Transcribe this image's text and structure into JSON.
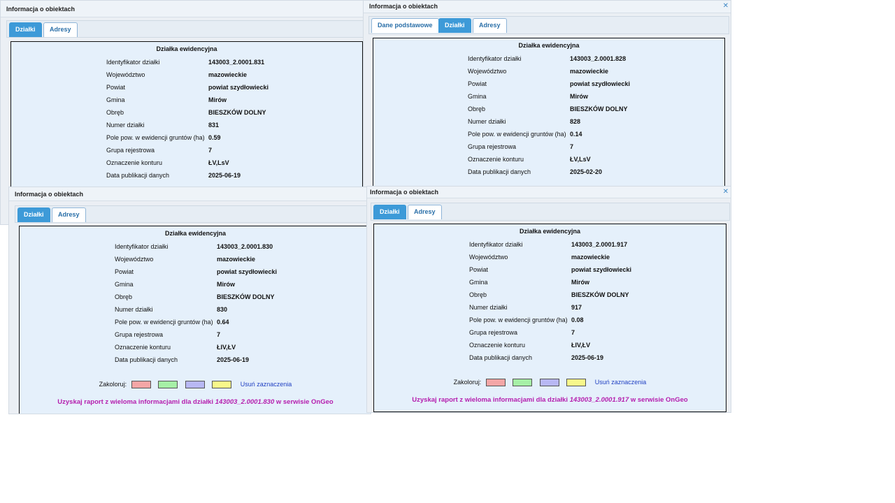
{
  "colors": {
    "tab_active_bg": "#3d9ad8",
    "panel_bg": "#e5f0fb",
    "report_text": "#b51eae",
    "clear_link": "#1f3fc2"
  },
  "icons": {
    "close": "close-icon"
  },
  "windows": [
    {
      "title": "Informacja o obiektach",
      "tabs": [
        {
          "label": "Działki",
          "active": true
        },
        {
          "label": "Adresy",
          "active": false
        }
      ],
      "panel_title": "Działka ewidencyjna",
      "rows": [
        {
          "label": "Identyfikator działki",
          "value": "143003_2.0001.831"
        },
        {
          "label": "Województwo",
          "value": "mazowieckie"
        },
        {
          "label": "Powiat",
          "value": "powiat szydłowiecki"
        },
        {
          "label": "Gmina",
          "value": "Mirów"
        },
        {
          "label": "Obręb",
          "value": "BIESZKÓW DOLNY"
        },
        {
          "label": "Numer działki",
          "value": "831"
        },
        {
          "label": "Pole pow. w ewidencji gruntów (ha)",
          "value": "0.59"
        },
        {
          "label": "Grupa rejestrowa",
          "value": "7"
        },
        {
          "label": "Oznaczenie konturu",
          "value": "ŁV,LsV"
        },
        {
          "label": "Data publikacji danych",
          "value": "2025-06-19"
        }
      ]
    },
    {
      "title": "Informacja o obiektach",
      "tabs": [
        {
          "label": "Dane podstawowe",
          "active": false
        },
        {
          "label": "Działki",
          "active": true
        },
        {
          "label": "Adresy",
          "active": false
        }
      ],
      "panel_title": "Działka ewidencyjna",
      "rows": [
        {
          "label": "Identyfikator działki",
          "value": "143003_2.0001.828"
        },
        {
          "label": "Województwo",
          "value": "mazowieckie"
        },
        {
          "label": "Powiat",
          "value": "powiat szydłowiecki"
        },
        {
          "label": "Gmina",
          "value": "Mirów"
        },
        {
          "label": "Obręb",
          "value": "BIESZKÓW DOLNY"
        },
        {
          "label": "Numer działki",
          "value": "828"
        },
        {
          "label": "Pole pow. w ewidencji gruntów (ha)",
          "value": "0.14"
        },
        {
          "label": "Grupa rejestrowa",
          "value": "7"
        },
        {
          "label": "Oznaczenie konturu",
          "value": "ŁV,LsV"
        },
        {
          "label": "Data publikacji danych",
          "value": "2025-02-20"
        }
      ]
    },
    {
      "title": "Informacja o obiektach",
      "tabs": [
        {
          "label": "Działki",
          "active": true
        },
        {
          "label": "Adresy",
          "active": false
        }
      ],
      "panel_title": "Działka ewidencyjna",
      "rows": [
        {
          "label": "Identyfikator działki",
          "value": "143003_2.0001.830"
        },
        {
          "label": "Województwo",
          "value": "mazowieckie"
        },
        {
          "label": "Powiat",
          "value": "powiat szydłowiecki"
        },
        {
          "label": "Gmina",
          "value": "Mirów"
        },
        {
          "label": "Obręb",
          "value": "BIESZKÓW DOLNY"
        },
        {
          "label": "Numer działki",
          "value": "830"
        },
        {
          "label": "Pole pow. w ewidencji gruntów (ha)",
          "value": "0.64"
        },
        {
          "label": "Grupa rejestrowa",
          "value": "7"
        },
        {
          "label": "Oznaczenie konturu",
          "value": "ŁIV,ŁV"
        },
        {
          "label": "Data publikacji danych",
          "value": "2025-06-19"
        }
      ],
      "zakoloruj_label": "Zakoloruj:",
      "swatch_colors": [
        "#f4a6a6",
        "#a6f0a6",
        "#b8b8f4",
        "#f8f88a"
      ],
      "clear_label": "Usuń zaznaczenia",
      "report": {
        "prefix": "Uzyskaj raport z wieloma informacjami dla działki",
        "parcel": "143003_2.0001.830",
        "suffix": "w serwisie OnGeo"
      }
    },
    {
      "title": "Informacja o obiektach",
      "tabs": [
        {
          "label": "Działki",
          "active": true
        },
        {
          "label": "Adresy",
          "active": false
        }
      ],
      "panel_title": "Działka ewidencyjna",
      "rows": [
        {
          "label": "Identyfikator działki",
          "value": "143003_2.0001.917"
        },
        {
          "label": "Województwo",
          "value": "mazowieckie"
        },
        {
          "label": "Powiat",
          "value": "powiat szydłowiecki"
        },
        {
          "label": "Gmina",
          "value": "Mirów"
        },
        {
          "label": "Obręb",
          "value": "BIESZKÓW DOLNY"
        },
        {
          "label": "Numer działki",
          "value": "917"
        },
        {
          "label": "Pole pow. w ewidencji gruntów (ha)",
          "value": "0.08"
        },
        {
          "label": "Grupa rejestrowa",
          "value": "7"
        },
        {
          "label": "Oznaczenie konturu",
          "value": "ŁIV,ŁV"
        },
        {
          "label": "Data publikacji danych",
          "value": "2025-06-19"
        }
      ],
      "zakoloruj_label": "Zakoloruj:",
      "swatch_colors": [
        "#f4a6a6",
        "#a6f0a6",
        "#b8b8f4",
        "#f8f88a"
      ],
      "clear_label": "Usuń zaznaczenia",
      "report": {
        "prefix": "Uzyskaj raport z wieloma informacjami dla działki",
        "parcel": "143003_2.0001.917",
        "suffix": "w serwisie OnGeo"
      }
    }
  ]
}
